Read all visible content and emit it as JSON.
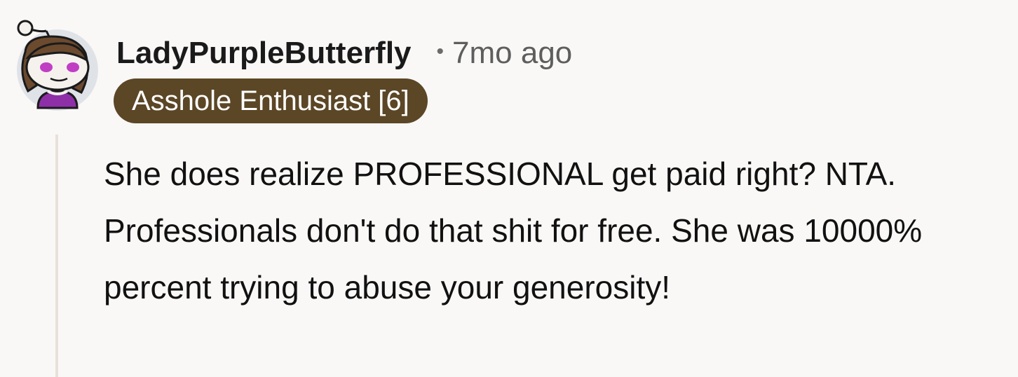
{
  "comment": {
    "author": "LadyPurpleButterfly",
    "separator": "•",
    "timestamp": "7mo ago",
    "flair": "Asshole Enthusiast [6]",
    "body": "She does realize PROFESSIONAL get paid right? NTA. Professionals don't do that shit for free. She was 10000% percent trying to abuse your generosity!"
  },
  "avatar": {
    "icon": "snoo-avatar-icon",
    "colors": {
      "background": "#dfe3e8",
      "hair": "#6b4a2e",
      "face": "#f5f2ee",
      "eyes": "#c03ec4",
      "outfit": "#8e2fa8"
    }
  },
  "colors": {
    "page_background": "#faf8f6",
    "flair_background": "#5b4626",
    "flair_text": "#ffffff",
    "thread_line": "#e8e1d9"
  }
}
